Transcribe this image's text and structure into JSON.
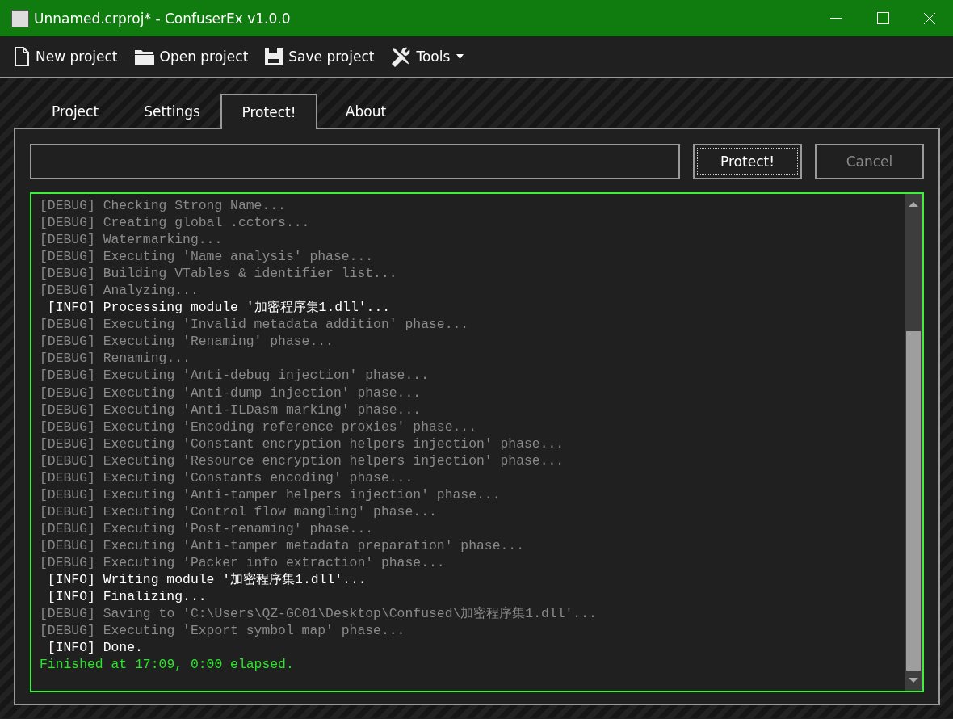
{
  "window": {
    "title": "Unnamed.crproj* - ConfuserEx v1.0.0"
  },
  "toolbar": [
    {
      "label": "New project",
      "kind": "new"
    },
    {
      "label": "Open project",
      "kind": "open"
    },
    {
      "label": "Save project",
      "kind": "save"
    },
    {
      "label": "Tools",
      "kind": "tools"
    }
  ],
  "tabs": [
    {
      "label": "Project",
      "selected": false
    },
    {
      "label": "Settings",
      "selected": false
    },
    {
      "label": "Protect!",
      "selected": true
    },
    {
      "label": "About",
      "selected": false
    }
  ],
  "progress": {
    "level": 0
  },
  "buttons": [
    {
      "label": "Protect!",
      "disabled": false,
      "focused": true
    },
    {
      "label": "Cancel",
      "disabled": true,
      "focused": false
    }
  ],
  "log": [
    {
      "kind": "debug",
      "text": "[DEBUG] Checking Strong Name..."
    },
    {
      "kind": "debug",
      "text": "[DEBUG] Creating global .cctors..."
    },
    {
      "kind": "debug",
      "text": "[DEBUG] Watermarking..."
    },
    {
      "kind": "debug",
      "text": "[DEBUG] Executing 'Name analysis' phase..."
    },
    {
      "kind": "debug",
      "text": "[DEBUG] Building VTables & identifier list..."
    },
    {
      "kind": "debug",
      "text": "[DEBUG] Analyzing..."
    },
    {
      "kind": "info",
      "text": "[INFO] Processing module '加密程序集1.dll'..."
    },
    {
      "kind": "debug",
      "text": "[DEBUG] Executing 'Invalid metadata addition' phase..."
    },
    {
      "kind": "debug",
      "text": "[DEBUG] Executing 'Renaming' phase..."
    },
    {
      "kind": "debug",
      "text": "[DEBUG] Renaming..."
    },
    {
      "kind": "debug",
      "text": "[DEBUG] Executing 'Anti-debug injection' phase..."
    },
    {
      "kind": "debug",
      "text": "[DEBUG] Executing 'Anti-dump injection' phase..."
    },
    {
      "kind": "debug",
      "text": "[DEBUG] Executing 'Anti-ILDasm marking' phase..."
    },
    {
      "kind": "debug",
      "text": "[DEBUG] Executing 'Encoding reference proxies' phase..."
    },
    {
      "kind": "debug",
      "text": "[DEBUG] Executing 'Constant encryption helpers injection' phase..."
    },
    {
      "kind": "debug",
      "text": "[DEBUG] Executing 'Resource encryption helpers injection' phase..."
    },
    {
      "kind": "debug",
      "text": "[DEBUG] Executing 'Constants encoding' phase..."
    },
    {
      "kind": "debug",
      "text": "[DEBUG] Executing 'Anti-tamper helpers injection' phase..."
    },
    {
      "kind": "debug",
      "text": "[DEBUG] Executing 'Control flow mangling' phase..."
    },
    {
      "kind": "debug",
      "text": "[DEBUG] Executing 'Post-renaming' phase..."
    },
    {
      "kind": "debug",
      "text": "[DEBUG] Executing 'Anti-tamper metadata preparation' phase..."
    },
    {
      "kind": "debug",
      "text": "[DEBUG] Executing 'Packer info extraction' phase..."
    },
    {
      "kind": "info",
      "text": "[INFO] Writing module '加密程序集1.dll'..."
    },
    {
      "kind": "info",
      "text": "[INFO] Finalizing..."
    },
    {
      "kind": "debug",
      "text": "[DEBUG] Saving to 'C:\\Users\\QZ-GC01\\Desktop\\Confused\\加密程序集1.dll'..."
    },
    {
      "kind": "debug",
      "text": "[DEBUG] Executing 'Export symbol map' phase..."
    },
    {
      "kind": "info",
      "text": "[INFO] Done."
    },
    {
      "kind": "success",
      "text": "Finished at 17:09, 0:00 elapsed."
    }
  ]
}
